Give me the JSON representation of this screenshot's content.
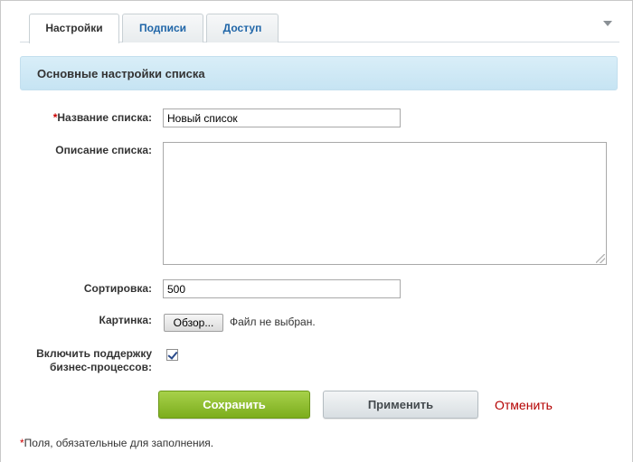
{
  "tabs": [
    {
      "label": "Настройки",
      "active": true
    },
    {
      "label": "Подписи",
      "active": false
    },
    {
      "label": "Доступ",
      "active": false
    }
  ],
  "collapse_icon": "chevron-down-icon",
  "section": {
    "title": "Основные настройки списка"
  },
  "form": {
    "name": {
      "required_mark": "*",
      "label": "Название списка:",
      "value": "Новый список"
    },
    "description": {
      "label": "Описание списка:",
      "value": ""
    },
    "sort": {
      "label": "Сортировка:",
      "value": "500"
    },
    "image": {
      "label": "Картинка:",
      "browse_label": "Обзор...",
      "file_status": "Файл не выбран."
    },
    "bizproc": {
      "label_line1": "Включить поддержку",
      "label_line2": "бизнес-процессов:",
      "checked": true
    }
  },
  "buttons": {
    "save": "Сохранить",
    "apply": "Применить",
    "cancel": "Отменить"
  },
  "footnote": {
    "mark": "*",
    "text": "Поля, обязательные для заполнения."
  },
  "colors": {
    "accent_tab": "#2066a8",
    "section_bg": "#c6e4f3",
    "save_green": "#7cad1d",
    "cancel_red": "#b40000",
    "required_red": "#cc0000"
  }
}
